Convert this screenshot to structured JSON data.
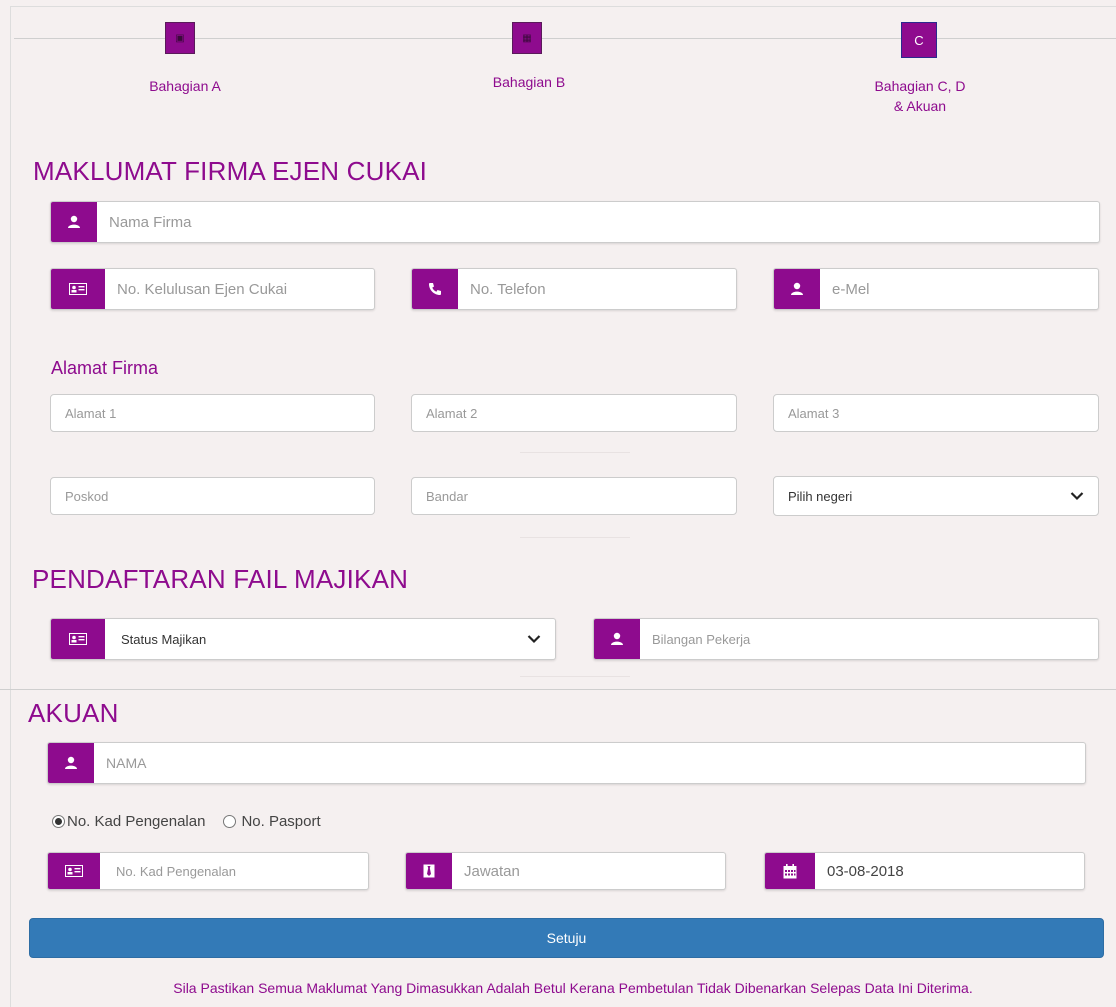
{
  "stepper": {
    "steps": [
      {
        "button": "",
        "label": "Bahagian A"
      },
      {
        "button": "",
        "label": "Bahagian B"
      },
      {
        "button": "C",
        "label_line1": "Bahagian C, D",
        "label_line2": "& Akuan"
      }
    ]
  },
  "firma": {
    "title": "MAKLUMAT FIRMA EJEN CUKAI",
    "nama_placeholder": "Nama Firma",
    "kelulusan_placeholder": "No. Kelulusan Ejen Cukai",
    "telefon_placeholder": "No. Telefon",
    "email_placeholder": "e-Mel"
  },
  "alamat": {
    "title": "Alamat Firma",
    "alamat1_placeholder": "Alamat 1",
    "alamat2_placeholder": "Alamat 2",
    "alamat3_placeholder": "Alamat 3",
    "poskod_placeholder": "Poskod",
    "bandar_placeholder": "Bandar",
    "negeri_selected": "Pilih negeri"
  },
  "majikan": {
    "title": "PENDAFTARAN FAIL MAJIKAN",
    "status_selected": "Status Majikan",
    "bilangan_placeholder": "Bilangan Pekerja"
  },
  "akuan": {
    "title": "AKUAN",
    "nama_placeholder": "NAMA",
    "radio_ic": "No. Kad Pengenalan",
    "radio_passport": "No. Pasport",
    "ic_placeholder": "No. Kad Pengenalan",
    "jawatan_placeholder": "Jawatan",
    "date_value": "03-08-2018"
  },
  "actions": {
    "submit_label": "Setuju",
    "notice": "Sila Pastikan Semua Maklumat Yang Dimasukkan Adalah Betul Kerana Pembetulan Tidak Dibenarkan Selepas Data Ini Diterima."
  },
  "colors": {
    "accent": "#8e0b8e",
    "button": "#337ab7",
    "background": "#f5f0f0"
  }
}
